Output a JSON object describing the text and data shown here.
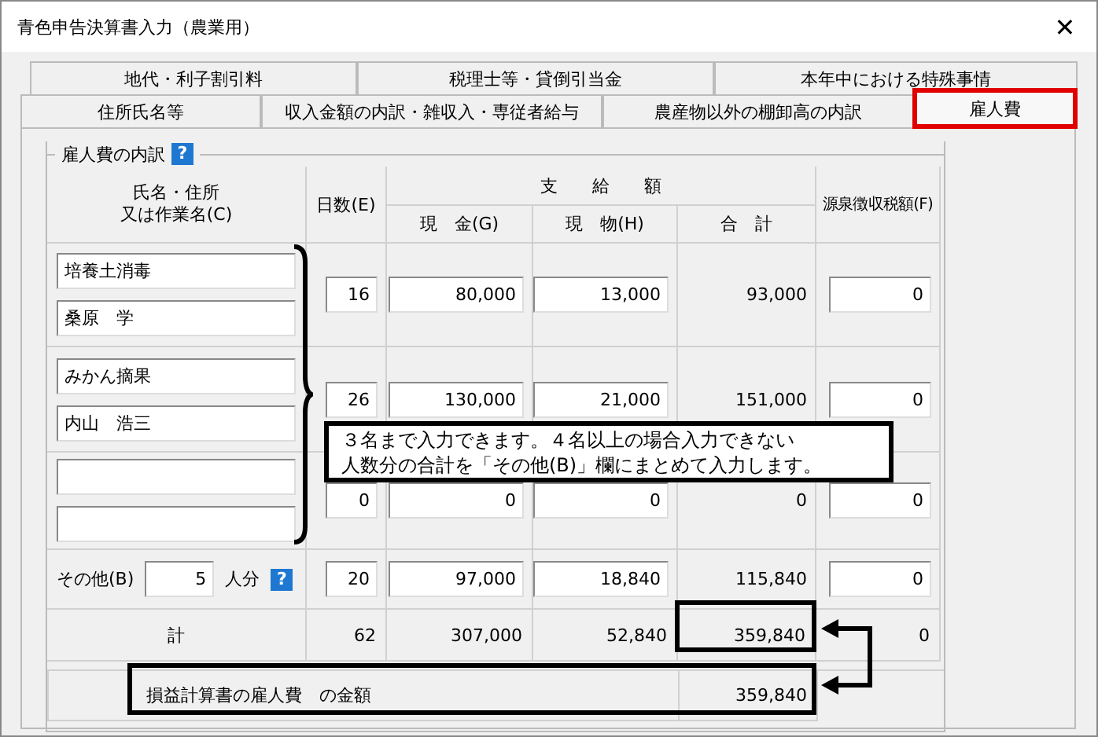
{
  "window": {
    "title": "青色申告決算書入力（農業用）",
    "close": "✕"
  },
  "tab_rows": [
    [
      {
        "label": "地代・利子割引料",
        "selected": false,
        "highlighted": false
      },
      {
        "label": "税理士等・貸倒引当金",
        "selected": false,
        "highlighted": false
      },
      {
        "label": "本年中における特殊事情",
        "selected": false,
        "highlighted": false
      }
    ],
    [
      {
        "label": "住所氏名等",
        "selected": false,
        "highlighted": false
      },
      {
        "label": "収入金額の内訳・雑収入・専従者給与",
        "selected": false,
        "highlighted": false
      },
      {
        "label": "農産物以外の棚卸高の内訳",
        "selected": false,
        "highlighted": false
      },
      {
        "label": "雇人費",
        "selected": true,
        "highlighted": true
      }
    ]
  ],
  "section": {
    "title": "雇人費の内訳",
    "help": "?"
  },
  "headers": {
    "name": [
      "氏名・住所",
      "又は作業名(C)"
    ],
    "days": "日数(E)",
    "paid": "支　　給　　額",
    "cash": "現　金(G)",
    "goods": "現　物(H)",
    "sum": "合　計",
    "withheld": "源泉徴収税額(F)"
  },
  "rows": [
    {
      "lines": [
        "培養土消毒",
        "桑原　学"
      ],
      "days": "16",
      "cash": "80,000",
      "goods": "13,000",
      "total": "93,000",
      "withheld": "0"
    },
    {
      "lines": [
        "みかん摘果",
        "内山　浩三"
      ],
      "days": "26",
      "cash": "130,000",
      "goods": "21,000",
      "total": "151,000",
      "withheld": "0"
    },
    {
      "lines": [],
      "days": "0",
      "cash": "0",
      "goods": "0",
      "total": "0",
      "withheld": "0"
    }
  ],
  "other": {
    "label": "その他(B)",
    "count": "5",
    "unit": "人分",
    "help": "?",
    "days": "20",
    "cash": "97,000",
    "goods": "18,840",
    "total": "115,840",
    "withheld": "0"
  },
  "total_row": {
    "label": "計",
    "days": "62",
    "cash": "307,000",
    "goods": "52,840",
    "total": "359,840",
    "withheld": "0"
  },
  "summary": {
    "label": "損益計算書の雇人費　の金額",
    "value": "359,840"
  },
  "callout": [
    "３名まで入力できます。４名以上の場合入力できない",
    "人数分の合計を「その他(B)」欄にまとめて入力します。"
  ]
}
